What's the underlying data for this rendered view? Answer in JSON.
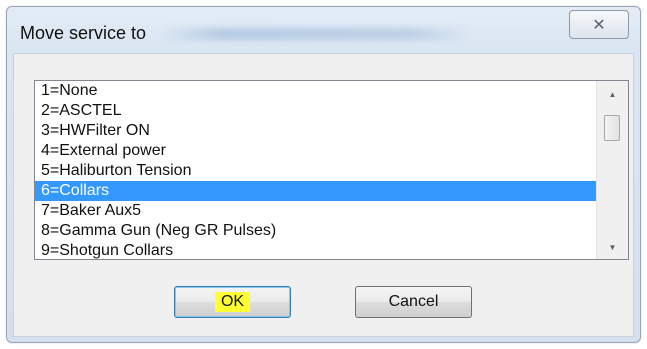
{
  "window": {
    "title": "Move service to",
    "close_glyph": "✕"
  },
  "list": {
    "items": [
      {
        "label": "1=None",
        "selected": false
      },
      {
        "label": "2=ASCTEL",
        "selected": false
      },
      {
        "label": "3=HWFilter ON",
        "selected": false
      },
      {
        "label": "4=External power",
        "selected": false
      },
      {
        "label": "5=Haliburton Tension",
        "selected": false
      },
      {
        "label": "6=Collars",
        "selected": true
      },
      {
        "label": "7=Baker Aux5",
        "selected": false
      },
      {
        "label": "8=Gamma Gun (Neg GR Pulses)",
        "selected": false
      },
      {
        "label": "9=Shotgun Collars",
        "selected": false
      }
    ],
    "scroll_up_icon": "▲",
    "scroll_down_icon": "▼"
  },
  "buttons": {
    "ok_label": "OK",
    "cancel_label": "Cancel"
  },
  "colors": {
    "selection": "#3399ff",
    "ok_highlight": "#ffff33"
  }
}
